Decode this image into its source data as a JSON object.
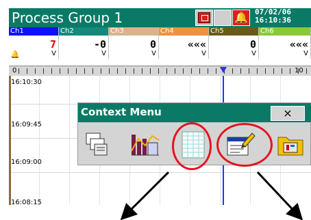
{
  "app": {
    "title": "Process Group 1",
    "date": "07/02/06",
    "time": "16:10:36"
  },
  "channels": [
    {
      "name": "Ch1",
      "value": "7",
      "unit": "V",
      "color": "#1010ff",
      "value_color": "#e00000",
      "alarm": true
    },
    {
      "name": "Ch2",
      "value": "-0",
      "unit": "V",
      "color": "#138a7c",
      "value_color": "#000000",
      "alarm": false
    },
    {
      "name": "Ch3",
      "value": "0",
      "unit": "V",
      "color": "#d8b48a",
      "value_color": "#000000",
      "alarm": false
    },
    {
      "name": "Ch4",
      "value": "«««",
      "unit": "V",
      "color": "#f09040",
      "value_color": "#000000",
      "alarm": false
    },
    {
      "name": "Ch5",
      "value": "0",
      "unit": "V",
      "color": "#6a5a1a",
      "value_color": "#000000",
      "alarm": false
    },
    {
      "name": "Ch6",
      "value": "«««",
      "unit": "V",
      "color": "#8ac838",
      "value_color": "#000000",
      "alarm": false
    }
  ],
  "scale": {
    "min_label": "0",
    "max_label": "10"
  },
  "times": [
    "16:10:30",
    "16:09:45",
    "16:09:00",
    "16:08:15"
  ],
  "context_menu": {
    "title": "Context Menu",
    "close_label": "×",
    "items": [
      {
        "name": "windows-item",
        "icon": "windows-icon"
      },
      {
        "name": "trend-chart-item",
        "icon": "trend-chart-icon"
      },
      {
        "name": "grid-item",
        "icon": "grid-icon",
        "highlighted": true
      },
      {
        "name": "edit-form-item",
        "icon": "edit-form-icon",
        "highlighted": true
      },
      {
        "name": "folder-tools-item",
        "icon": "folder-tools-icon"
      }
    ]
  },
  "colors": {
    "title_bar": "#0a7a66",
    "highlight": "#e4141e",
    "cursor_line": "#2233ff"
  }
}
